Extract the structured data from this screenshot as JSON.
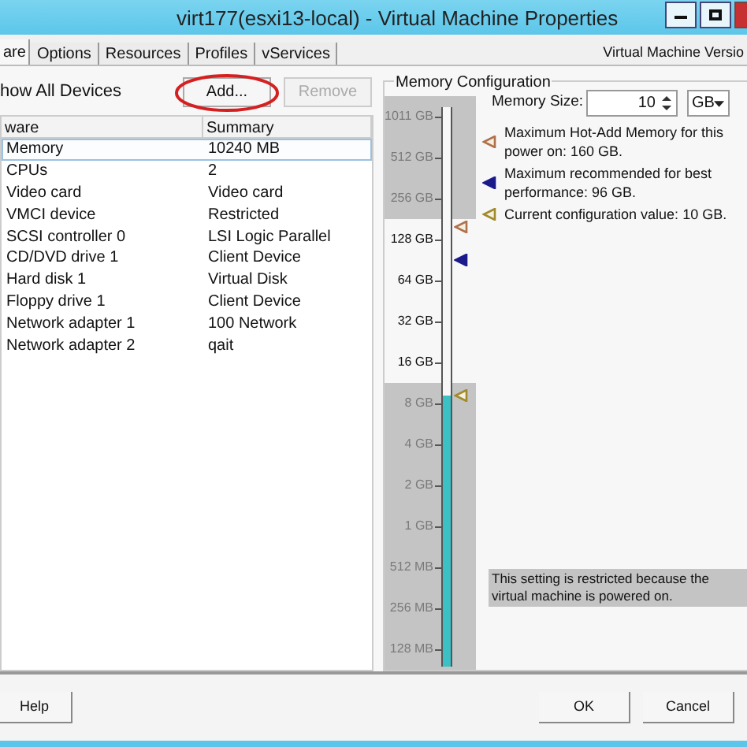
{
  "window": {
    "title": "virt177(esxi13-local) - Virtual Machine Properties"
  },
  "tabs": [
    {
      "label": "are",
      "selected": true
    },
    {
      "label": "Options",
      "selected": false
    },
    {
      "label": "Resources",
      "selected": false
    },
    {
      "label": "Profiles",
      "selected": false
    },
    {
      "label": "vServices",
      "selected": false
    }
  ],
  "version_label": "Virtual Machine Versio",
  "show_all_devices": "how All Devices",
  "buttons": [
    {
      "label": "Add...",
      "disabled": false,
      "highlighted": true
    },
    {
      "label": "Remove",
      "disabled": true,
      "highlighted": false
    }
  ],
  "table": {
    "columns": [
      "ware",
      "Summary"
    ],
    "rows": [
      {
        "cells": [
          "Memory",
          "10240 MB"
        ],
        "selected": true
      },
      {
        "cells": [
          "CPUs",
          "2"
        ],
        "selected": false
      },
      {
        "cells": [
          "Video card",
          "Video card"
        ],
        "selected": false
      },
      {
        "cells": [
          "VMCI device",
          "Restricted"
        ],
        "selected": false
      },
      {
        "cells": [
          "SCSI controller 0",
          "LSI Logic Parallel"
        ],
        "selected": false
      },
      {
        "cells": [
          "CD/DVD drive 1",
          "Client Device"
        ],
        "selected": false
      },
      {
        "cells": [
          "Hard disk 1",
          "Virtual Disk"
        ],
        "selected": false
      },
      {
        "cells": [
          "Floppy drive 1",
          "Client Device"
        ],
        "selected": false
      },
      {
        "cells": [
          "Network adapter 1",
          "100 Network"
        ],
        "selected": false
      },
      {
        "cells": [
          "Network adapter 2",
          "qait"
        ],
        "selected": false
      }
    ]
  },
  "memory": {
    "title": "Memory Configuration",
    "size_label": "Memory Size:",
    "size_value": "10",
    "unit": "GB",
    "slider": {
      "level": 0.49,
      "pointers": [
        {
          "level": 0.8,
          "color": "#b0704a",
          "filled": false
        },
        {
          "level": 0.74,
          "color": "#1a1a8c",
          "filled": true
        },
        {
          "level": 0.49,
          "color": "#a08a2a",
          "filled": false
        }
      ],
      "ticks": [
        {
          "label": "1011 GB",
          "dimmed": true
        },
        {
          "label": "512 GB",
          "dimmed": true
        },
        {
          "label": "256 GB",
          "dimmed": true
        },
        {
          "label": "128 GB",
          "dimmed": false
        },
        {
          "label": "64 GB",
          "dimmed": false
        },
        {
          "label": "32 GB",
          "dimmed": false
        },
        {
          "label": "16 GB",
          "dimmed": false
        },
        {
          "label": "8 GB",
          "dimmed": true
        },
        {
          "label": "4 GB",
          "dimmed": true
        },
        {
          "label": "2 GB",
          "dimmed": true
        },
        {
          "label": "1 GB",
          "dimmed": true
        },
        {
          "label": "512 MB",
          "dimmed": true
        },
        {
          "label": "256 MB",
          "dimmed": true
        },
        {
          "label": "128 MB",
          "dimmed": true
        }
      ]
    },
    "markers": [
      {
        "text": "Maximum Hot-Add Memory for this power on: 160 GB.",
        "color": "#b0704a",
        "filled": false
      },
      {
        "text": "Maximum recommended for best performance: 96 GB.",
        "color": "#1a1a8c",
        "filled": true
      },
      {
        "text": "Current configuration value: 10 GB.",
        "color": "#a08a2a",
        "filled": false
      }
    ],
    "notice": "This setting is restricted because the virtual machine is powered on."
  },
  "footer_buttons": [
    {
      "label": "Help"
    },
    {
      "label": "OK"
    },
    {
      "label": "Cancel"
    }
  ]
}
